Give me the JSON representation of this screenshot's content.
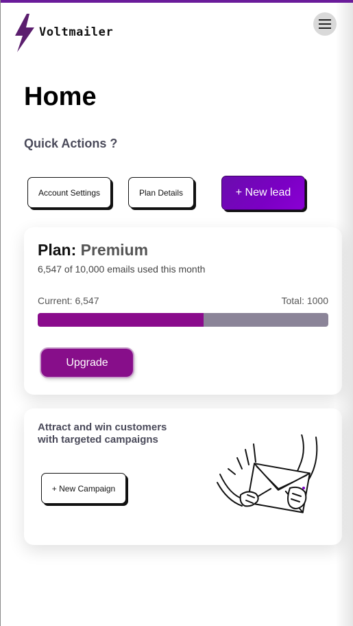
{
  "brand": {
    "name": "Voltmailer",
    "logo_icon": "lightning-bolt-icon",
    "color": "#5b1e6e"
  },
  "header": {
    "menu_icon": "hamburger-menu-icon"
  },
  "page": {
    "title": "Home"
  },
  "quick_actions": {
    "title": "Quick Actions ?",
    "account_settings_label": "Account Settings",
    "plan_details_label": "Plan Details",
    "new_lead_label": "+ New lead"
  },
  "plan": {
    "label": "Plan:",
    "name": "Premium",
    "usage_text": "6,547 of 10,000 emails used this month",
    "current_label": "Current: 6,547",
    "total_label": "Total: 1000",
    "progress_fraction": 0.57,
    "upgrade_label": "Upgrade"
  },
  "campaign": {
    "headline": "Attract and win customers with targeted campaigns",
    "new_campaign_label": "+ New Campaign",
    "illustration_icon": "hands-holding-envelope-icon"
  },
  "colors": {
    "accent": "#6a1b9a",
    "new_lead_button": "#7b00c4",
    "upgrade_button": "#870e8a",
    "progress_fill": "#8a0b8c",
    "progress_track": "#8b8498"
  }
}
